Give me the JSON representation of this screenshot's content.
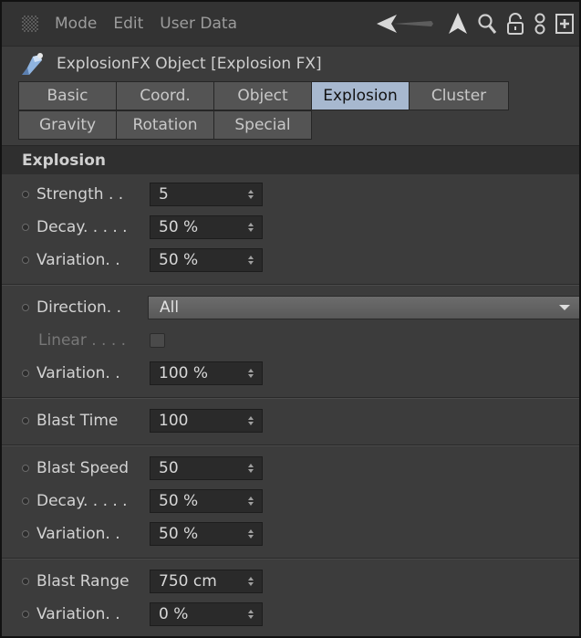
{
  "menu": {
    "items": [
      "Mode",
      "Edit",
      "User Data"
    ]
  },
  "toolbar": {
    "icons": [
      "back-arrow-icon",
      "pointer-icon",
      "search-icon",
      "lock-icon",
      "link-icon",
      "new-panel-icon"
    ]
  },
  "object": {
    "title": "ExplosionFX Object [Explosion FX]",
    "icon": "explosion-object-icon"
  },
  "tabs": {
    "row1": [
      "Basic",
      "Coord.",
      "Object",
      "Explosion",
      "Cluster"
    ],
    "row2": [
      "Gravity",
      "Rotation",
      "Special"
    ],
    "active": "Explosion"
  },
  "section": {
    "title": "Explosion"
  },
  "groups": {
    "g1": [
      {
        "label": "Strength . .",
        "value": "5"
      },
      {
        "label": "Decay. . . . .",
        "value": "50 %"
      },
      {
        "label": "Variation. .",
        "value": "50 %"
      }
    ],
    "g2": {
      "direction": {
        "label": "Direction. .",
        "value": "All"
      },
      "linear": {
        "label": "Linear . . . ."
      },
      "variation": {
        "label": "Variation. .",
        "value": "100 %"
      }
    },
    "g3": [
      {
        "label": "Blast Time",
        "value": "100"
      }
    ],
    "g4": [
      {
        "label": "Blast Speed",
        "value": "50"
      },
      {
        "label": "Decay. . . . .",
        "value": "50 %"
      },
      {
        "label": "Variation. .",
        "value": "50 %"
      }
    ],
    "g5": [
      {
        "label": "Blast Range",
        "value": "750 cm"
      },
      {
        "label": "Variation. .",
        "value": "0 %"
      }
    ]
  }
}
